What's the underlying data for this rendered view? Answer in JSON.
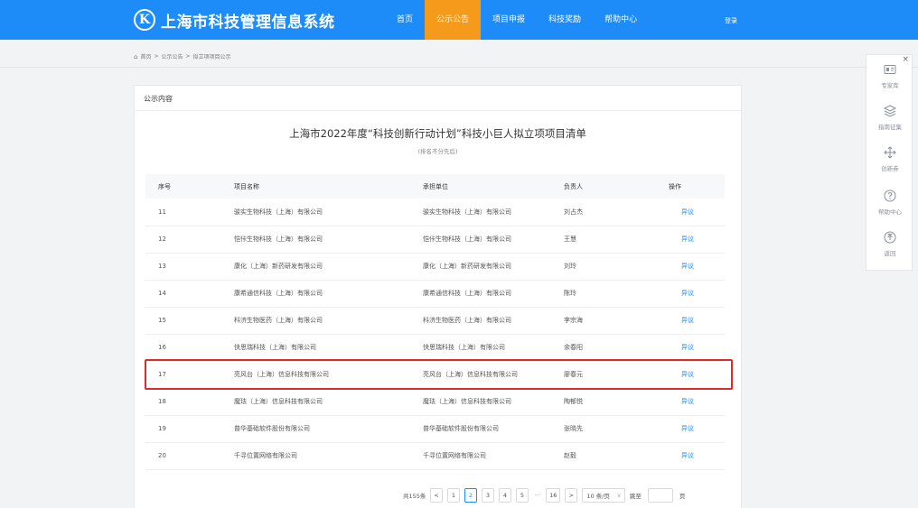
{
  "header": {
    "logo_letter": "K",
    "system_title": "上海市科技管理信息系统",
    "nav": [
      "首页",
      "公示公告",
      "项目申报",
      "科技奖励",
      "帮助中心"
    ],
    "active_nav": 1,
    "login_label": "登录"
  },
  "breadcrumb": [
    "首页",
    ">",
    "公示公告",
    ">",
    "拟立项项目公示"
  ],
  "panel": {
    "title": "公示内容",
    "list_title": "上海市2022年度“科技创新行动计划”科技小巨人拟立项项目清单",
    "list_subtitle": "(排名不分先后)"
  },
  "table": {
    "headers": [
      "序号",
      "项目名称",
      "承担单位",
      "负责人",
      "操作"
    ],
    "rows": [
      [
        "11",
        "骏实生物科技（上海）有限公司",
        "骏实生物科技（上海）有限公司",
        "刘占杰",
        "异议"
      ],
      [
        "12",
        "恺佧生物科技（上海）有限公司",
        "恺佧生物科技（上海）有限公司",
        "王慧",
        "异议"
      ],
      [
        "13",
        "康化（上海）新药研发有限公司",
        "康化（上海）新药研发有限公司",
        "刘玲",
        "异议"
      ],
      [
        "14",
        "康希通信科技（上海）有限公司",
        "康希通信科技（上海）有限公司",
        "陈玲",
        "异议"
      ],
      [
        "15",
        "科济生物医药（上海）有限公司",
        "科济生物医药（上海）有限公司",
        "李宗海",
        "异议"
      ],
      [
        "16",
        "快思瑞科技（上海）有限公司",
        "快思瑞科技（上海）有限公司",
        "余春阳",
        "异议"
      ],
      [
        "17",
        "亮风台（上海）信息科技有限公司",
        "亮风台（上海）信息科技有限公司",
        "廖春元",
        "异议"
      ],
      [
        "18",
        "魔珐（上海）信息科技有限公司",
        "魔珐（上海）信息科技有限公司",
        "陶郁悦",
        "异议"
      ],
      [
        "19",
        "普华基础软件股份有限公司",
        "普华基础软件股份有限公司",
        "张晓先",
        "异议"
      ],
      [
        "20",
        "千寻位置网络有限公司",
        "千寻位置网络有限公司",
        "赵毅",
        "异议"
      ]
    ],
    "highlighted_row": "17"
  },
  "pager": {
    "total": "共155条",
    "prev": "<",
    "pages": [
      "1",
      "2",
      "3",
      "4",
      "5"
    ],
    "current": "2",
    "ellipsis": "···",
    "last_page": "16",
    "next": ">",
    "page_size": "10 条/页",
    "page_size_caret": "∨",
    "jump_label": "跳至",
    "jump_suffix": "页"
  },
  "side_toolbar": {
    "close": "×",
    "items": [
      {
        "label": "专家库",
        "icon": "id-card-icon"
      },
      {
        "label": "指南征集",
        "icon": "layers-icon"
      },
      {
        "label": "创新券",
        "icon": "move-icon"
      },
      {
        "label": "帮助中心",
        "icon": "question-icon"
      },
      {
        "label": "返回",
        "icon": "back-to-top-icon"
      }
    ]
  },
  "colors": {
    "header_blue": "#1d8cf8",
    "active_nav_orange": "#f69a1c",
    "link_blue": "#1d8cf8",
    "highlight_red": "#e02b27"
  }
}
